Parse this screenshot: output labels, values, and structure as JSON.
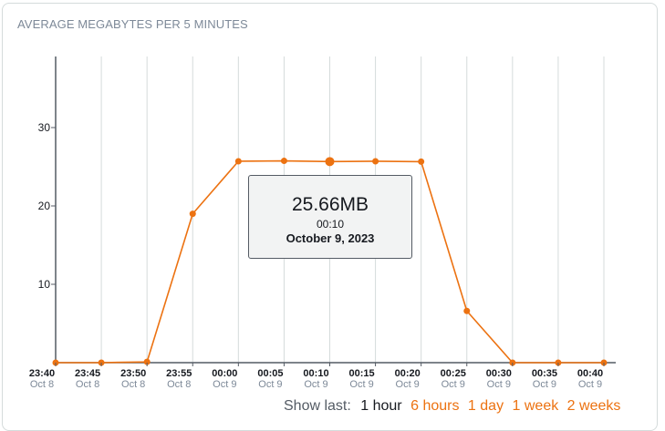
{
  "card": {
    "title": "AVERAGE MEGABYTES PER 5 MINUTES"
  },
  "colors": {
    "series": "#ec7211",
    "grid": "#d5dbdb",
    "axis": "#545b64",
    "link": "#ec7211"
  },
  "chart_data": {
    "type": "line",
    "title": "AVERAGE MEGABYTES PER 5 MINUTES",
    "xlabel": "",
    "ylabel": "",
    "ylim": [
      0,
      36
    ],
    "yticks": [
      10,
      20,
      30
    ],
    "grid": "vertical",
    "categories": [
      {
        "time": "23:40",
        "date": "Oct 8"
      },
      {
        "time": "23:45",
        "date": "Oct 8"
      },
      {
        "time": "23:50",
        "date": "Oct 8"
      },
      {
        "time": "23:55",
        "date": "Oct 8"
      },
      {
        "time": "00:00",
        "date": "Oct 9"
      },
      {
        "time": "00:05",
        "date": "Oct 9"
      },
      {
        "time": "00:10",
        "date": "Oct 9"
      },
      {
        "time": "00:15",
        "date": "Oct 9"
      },
      {
        "time": "00:20",
        "date": "Oct 9"
      },
      {
        "time": "00:25",
        "date": "Oct 9"
      },
      {
        "time": "00:30",
        "date": "Oct 9"
      },
      {
        "time": "00:35",
        "date": "Oct 9"
      },
      {
        "time": "00:40",
        "date": "Oct 9"
      }
    ],
    "series": [
      {
        "values": [
          0,
          0,
          0.1,
          19,
          25.7,
          25.75,
          25.66,
          25.7,
          25.65,
          6.6,
          0,
          0,
          0
        ]
      }
    ],
    "highlight_index": 6
  },
  "tooltip": {
    "value": "25.66MB",
    "time": "00:10",
    "date": "October 9, 2023"
  },
  "range_selector": {
    "label": "Show last:",
    "options": [
      {
        "label": "1 hour",
        "selected": true
      },
      {
        "label": "6 hours",
        "selected": false
      },
      {
        "label": "1 day",
        "selected": false
      },
      {
        "label": "1 week",
        "selected": false
      },
      {
        "label": "2 weeks",
        "selected": false
      }
    ]
  }
}
